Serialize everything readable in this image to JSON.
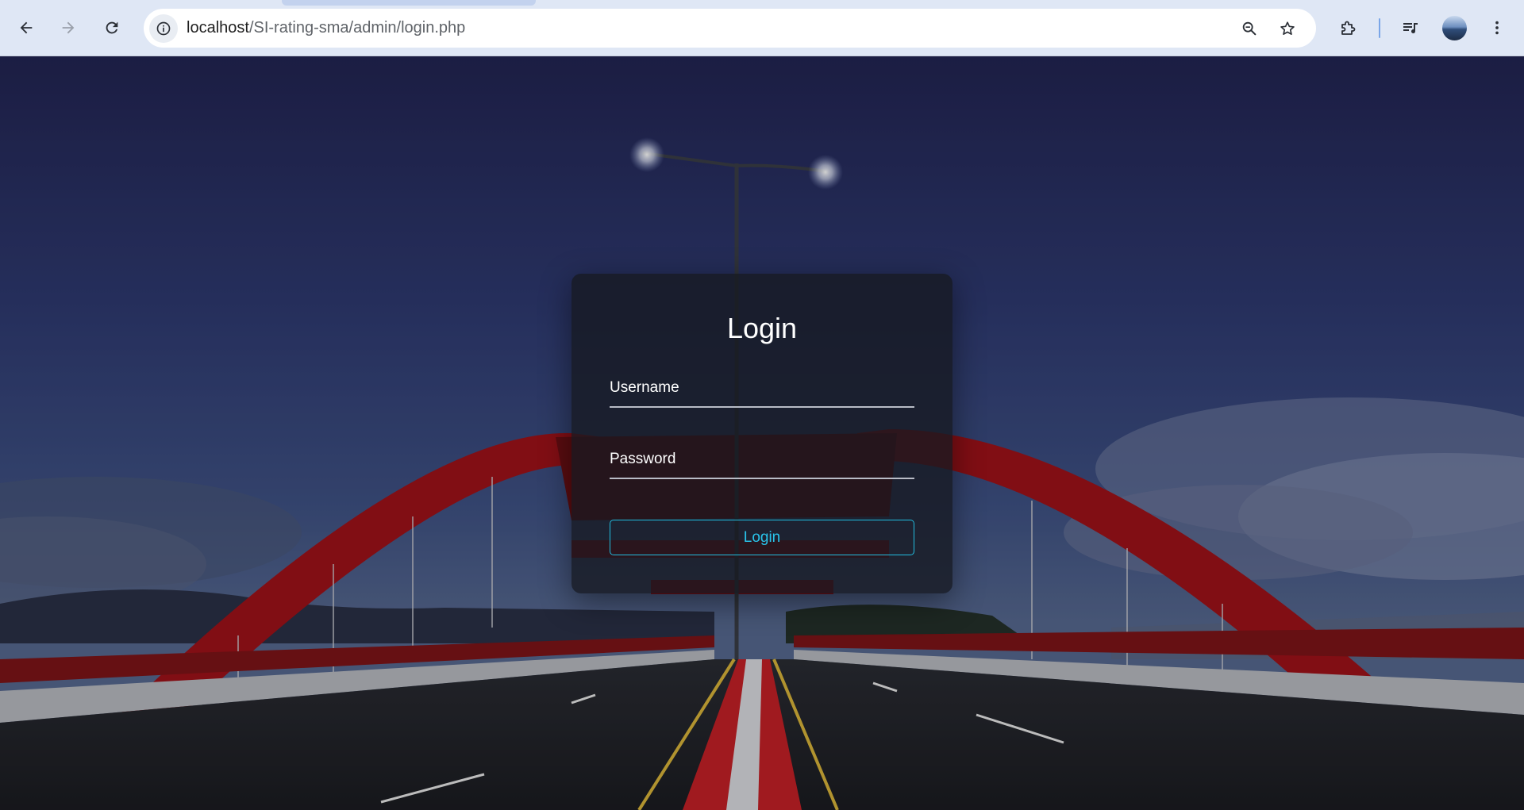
{
  "browser": {
    "url_host": "localhost",
    "url_path": "/SI-rating-sma/admin/login.php",
    "icons": {
      "back": "arrow-left-icon",
      "forward": "arrow-right-icon",
      "reload": "reload-icon",
      "site_info": "info-icon",
      "zoom": "zoom-out-icon",
      "bookmark": "star-icon",
      "extensions": "puzzle-icon",
      "media": "media-control-icon",
      "profile": "avatar",
      "menu": "kebab-menu-icon"
    }
  },
  "login": {
    "title": "Login",
    "username_label": "Username",
    "password_label": "Password",
    "username_value": "",
    "password_value": "",
    "button_label": "Login"
  },
  "colors": {
    "chrome_bg": "#dfe7f5",
    "card_bg": "#16182099",
    "accent": "#29c3ea",
    "bridge_red": "#b3141c"
  }
}
